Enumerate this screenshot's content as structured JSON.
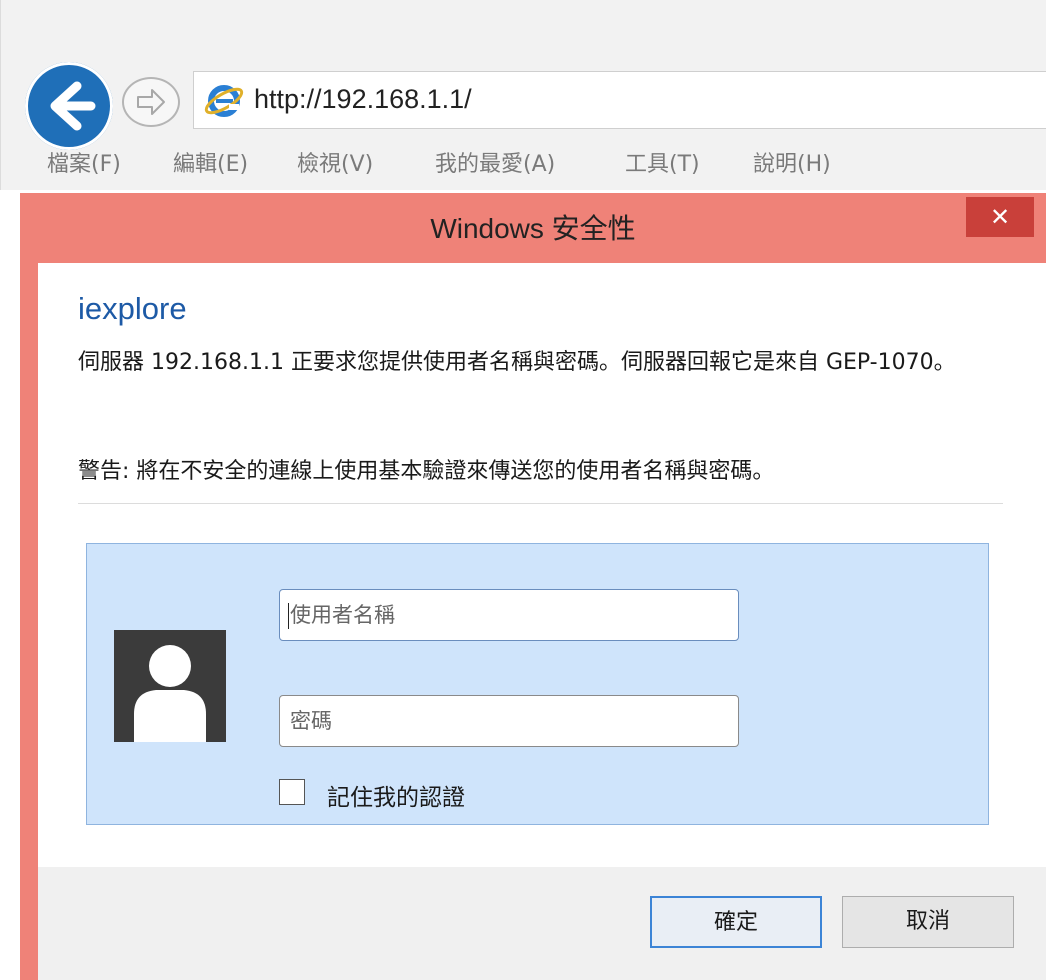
{
  "browser": {
    "address_url": "http://192.168.1.1/",
    "menu": [
      "檔案(F)",
      "編輯(E)",
      "檢視(V)",
      "我的最愛(A)",
      "工具(T)",
      "說明(H)"
    ]
  },
  "dialog": {
    "title": "Windows 安全性",
    "close_symbol": "✕",
    "app_name": "iexplore",
    "message": "伺服器 192.168.1.1 正要求您提供使用者名稱與密碼。伺服器回報它是來自 GEP-1070。",
    "warning": "警告: 將在不安全的連線上使用基本驗證來傳送您的使用者名稱與密碼。",
    "username_placeholder": "使用者名稱",
    "password_placeholder": "密碼",
    "remember_label": "記住我的認證",
    "ok_label": "確定",
    "cancel_label": "取消"
  },
  "colors": {
    "dialog_frame": "#ef8278",
    "close_button": "#c9403a",
    "credential_panel": "#cfe4fb",
    "app_name": "#1d5aa6",
    "back_button": "#1f6fb8"
  },
  "icons": [
    "back-arrow-icon",
    "forward-arrow-icon",
    "ie-logo-icon",
    "close-icon",
    "user-avatar-icon"
  ]
}
